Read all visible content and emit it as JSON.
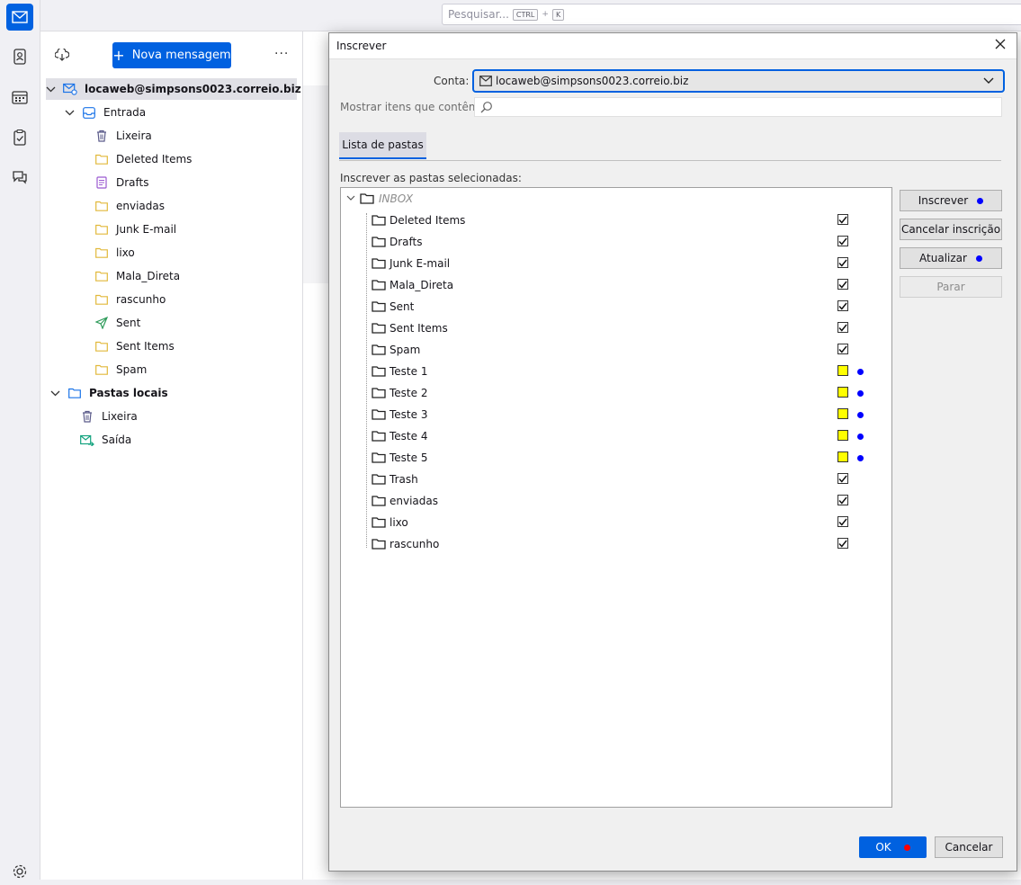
{
  "spaces": [
    {
      "name": "mail-icon",
      "active": true
    },
    {
      "name": "address-book-icon"
    },
    {
      "name": "calendar-icon"
    },
    {
      "name": "tasks-icon"
    },
    {
      "name": "chat-icon"
    },
    {
      "name": "settings-icon"
    }
  ],
  "search": {
    "placeholder": "Pesquisar...",
    "key1": "CTRL",
    "plus": "+",
    "key2": "K"
  },
  "folder_pane": {
    "new_message": "Nova mensagem",
    "more": "···",
    "account": "locaweb@simpsons0023.correio.biz",
    "inbox": "Entrada",
    "inbox_children": [
      "Lixeira",
      "Deleted Items",
      "Drafts",
      "enviadas",
      "Junk E-mail",
      "lixo",
      "Mala_Direta",
      "rascunho",
      "Sent",
      "Sent Items",
      "Spam"
    ],
    "local": "Pastas locais",
    "local_children": [
      "Lixeira",
      "Saída"
    ]
  },
  "dialog": {
    "title": "Inscrever",
    "account_label": "Conta:",
    "account_value": "locaweb@simpsons0023.correio.biz",
    "filter_label": "Mostrar itens que contêm:",
    "tab_label": "Lista de pastas",
    "tree_label": "Inscrever as pastas selecionadas:",
    "root": "INBOX",
    "folders": [
      {
        "name": "Deleted Items",
        "checked": true
      },
      {
        "name": "Drafts",
        "checked": true
      },
      {
        "name": "Junk E-mail",
        "checked": true
      },
      {
        "name": "Mala_Direta",
        "checked": true
      },
      {
        "name": "Sent",
        "checked": true
      },
      {
        "name": "Sent Items",
        "checked": true
      },
      {
        "name": "Spam",
        "checked": true
      },
      {
        "name": "Teste 1",
        "checked": false,
        "highlight": true
      },
      {
        "name": "Teste 2",
        "checked": false,
        "highlight": true
      },
      {
        "name": "Teste 3",
        "checked": false,
        "highlight": true
      },
      {
        "name": "Teste 4",
        "checked": false,
        "highlight": true
      },
      {
        "name": "Teste 5",
        "checked": false,
        "highlight": true
      },
      {
        "name": "Trash",
        "checked": true
      },
      {
        "name": "enviadas",
        "checked": true
      },
      {
        "name": "lixo",
        "checked": true
      },
      {
        "name": "rascunho",
        "checked": true
      }
    ],
    "buttons": {
      "subscribe": "Inscrever",
      "unsubscribe": "Cancelar inscrição",
      "refresh": "Atualizar",
      "stop": "Parar"
    },
    "ok": "OK",
    "cancel": "Cancelar"
  },
  "colors": {
    "accent": "#0061e0",
    "highlight": "#ffff00",
    "marker_blue": "#0000ff",
    "marker_red": "#ff0000"
  }
}
